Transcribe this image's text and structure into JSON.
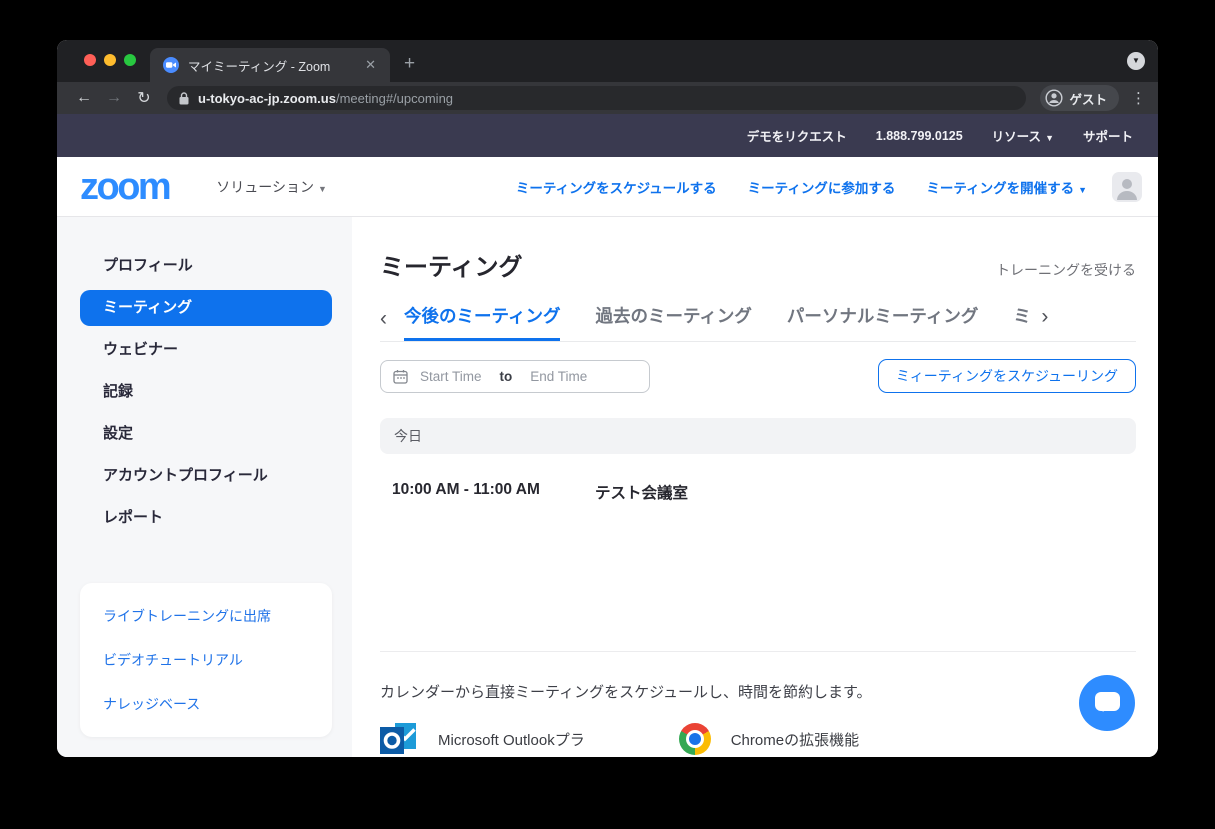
{
  "colors": {
    "accent": "#0e72ed",
    "brand_blue": "#2d8cff",
    "topbar_navy": "#3a3a50",
    "chat_blue": "#2e8cff"
  },
  "browser": {
    "tab_title": "マイミーティング - Zoom",
    "url_domain": "u-tokyo-ac-jp.zoom.us",
    "url_path": "/meeting#/upcoming",
    "guest_label": "ゲスト"
  },
  "topbar": {
    "links": [
      "デモをリクエスト",
      "1.888.799.0125",
      "リソース",
      "サポート"
    ]
  },
  "header": {
    "logo_text": "zoom",
    "solutions_label": "ソリューション",
    "nav": [
      "ミーティングをスケジュールする",
      "ミーティングに参加する",
      "ミーティングを開催する"
    ]
  },
  "sidebar": {
    "items": [
      "プロフィール",
      "ミーティング",
      "ウェビナー",
      "記録",
      "設定",
      "アカウントプロフィール",
      "レポート"
    ],
    "active_index": 1,
    "links": [
      "ライブトレーニングに出席",
      "ビデオチュートリアル",
      "ナレッジベース"
    ]
  },
  "main": {
    "title": "ミーティング",
    "training_link": "トレーニングを受ける",
    "tabs": [
      "今後のミーティング",
      "過去のミーティング",
      "パーソナルミーティング",
      "ミ"
    ],
    "active_tab_index": 0,
    "filter": {
      "start": "Start Time",
      "to": "to",
      "end": "End Time"
    },
    "schedule_button": "ミィーティングをスケジューリング",
    "section_label": "今日",
    "meetings": [
      {
        "time": "10:00 AM - 11:00 AM",
        "title": "テスト会議室"
      }
    ],
    "promo": {
      "text": "カレンダーから直接ミーティングをスケジュールし、時間を節約します。",
      "items": [
        "Microsoft Outlookプラ",
        "Chromeの拡張機能"
      ]
    }
  }
}
